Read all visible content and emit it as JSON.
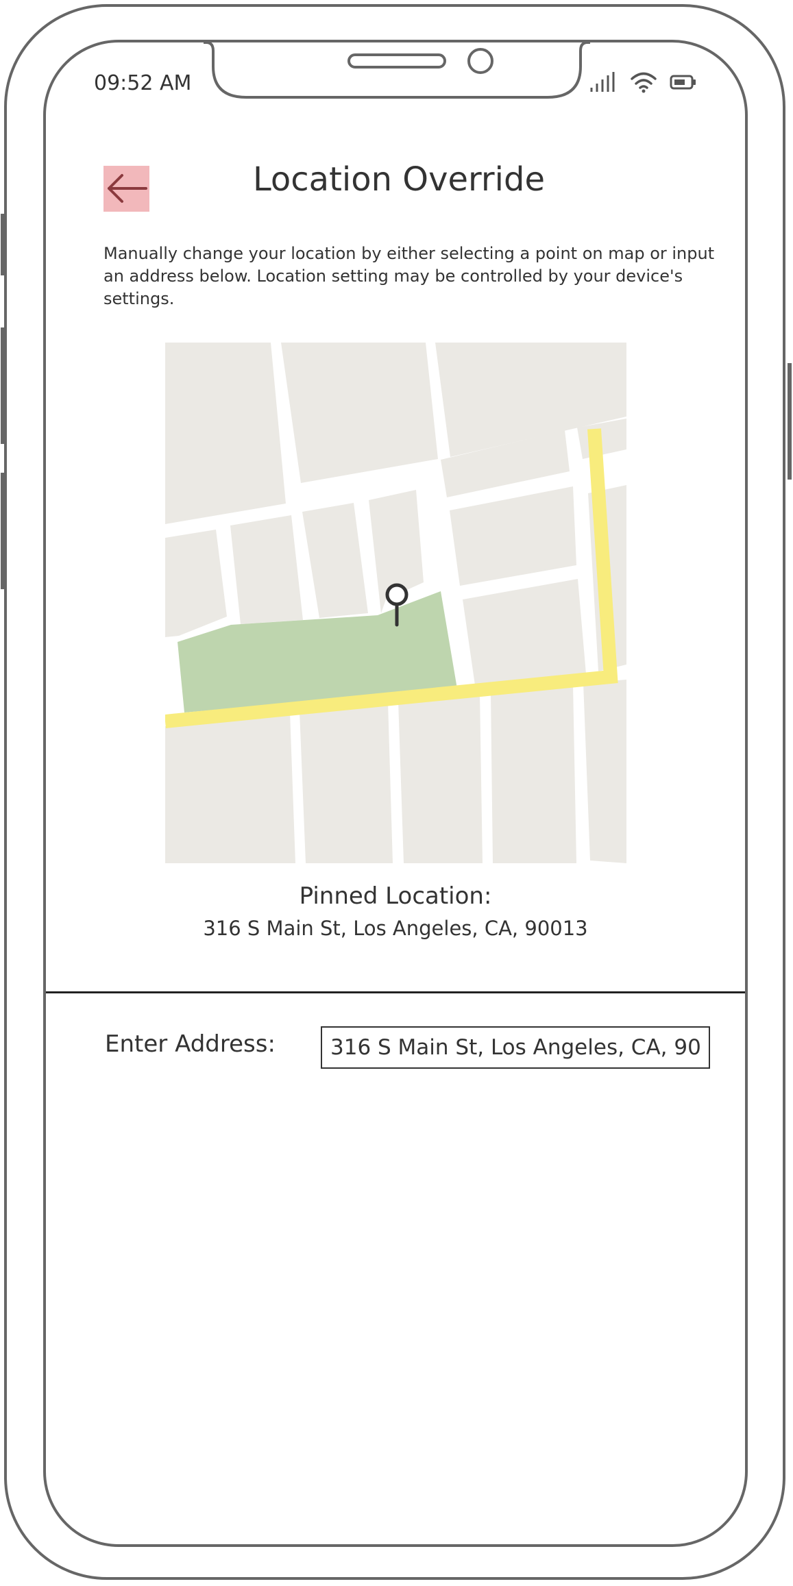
{
  "status_bar": {
    "time": "09:52 AM",
    "icons": [
      "signal-icon",
      "wifi-icon",
      "battery-icon"
    ]
  },
  "header": {
    "back_icon": "arrow-left-icon",
    "title": "Location Override"
  },
  "description": "Manually change your location by either selecting a point on map or input an address below. Location setting may be controlled by your device's settings.",
  "map": {
    "pin_icon": "map-pin-icon",
    "colors": {
      "block": "#ebe9e4",
      "park": "#bed5ae",
      "highway": "#f8ec7d",
      "street": "#ffffff",
      "pin": "#333333"
    }
  },
  "pinned": {
    "label": "Pinned Location:",
    "address": "316 S Main St, Los Angeles, CA, 90013"
  },
  "address_form": {
    "label": "Enter Address:",
    "value": "316 S Main St, Los Angeles, CA, 90"
  },
  "colors": {
    "frame": "#666666",
    "back_button_bg": "#f2b8bb",
    "back_arrow": "#8b3a3e"
  }
}
